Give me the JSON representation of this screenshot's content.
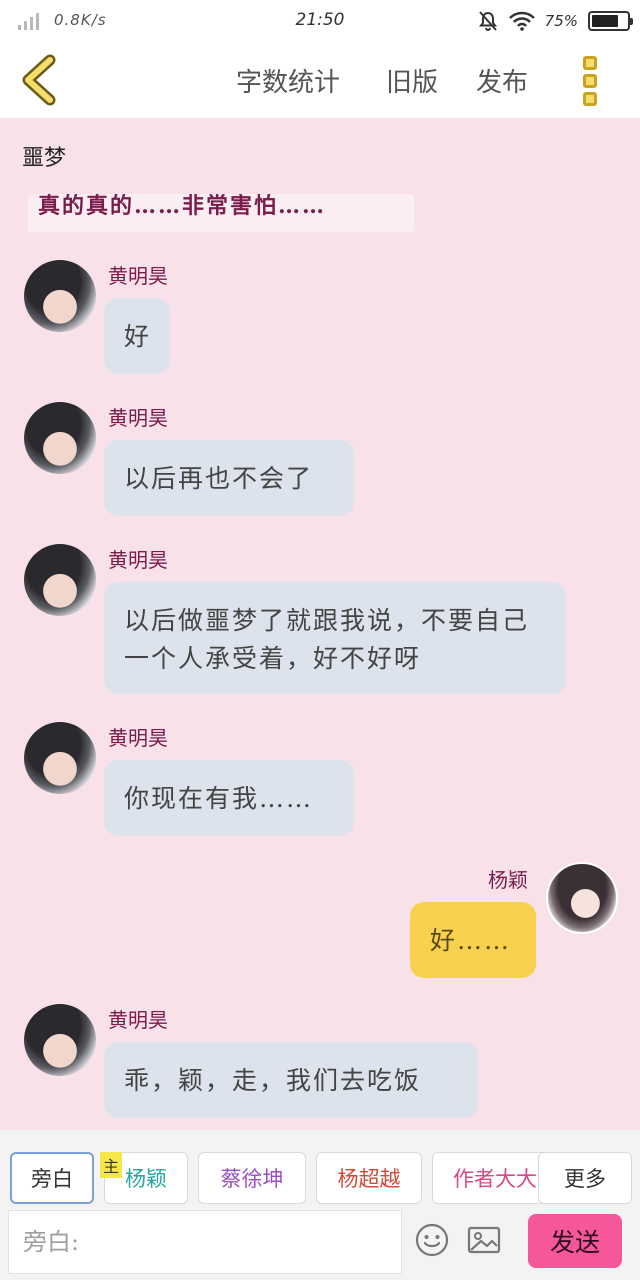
{
  "status_bar": {
    "speed": "0.8K/s",
    "time": "21:50",
    "battery_text": "75%",
    "battery_level": 0.75
  },
  "nav": {
    "word_count": "字数统计",
    "old_version": "旧版",
    "publish": "发布"
  },
  "chat": {
    "title": "噩梦",
    "cut_message": "真的真的……非常害怕……",
    "messages": [
      {
        "sender": "黄明昊",
        "text": "好",
        "side": "left"
      },
      {
        "sender": "黄明昊",
        "text": "以后再也不会了",
        "side": "left"
      },
      {
        "sender": "黄明昊",
        "text": "以后做噩梦了就跟我说，不要自己一个人承受着，好不好呀",
        "side": "left"
      },
      {
        "sender": "黄明昊",
        "text": "你现在有我……",
        "side": "left"
      },
      {
        "sender": "杨颖",
        "text": "好……",
        "side": "right"
      },
      {
        "sender": "黄明昊",
        "text": "乖，颖，走，我们去吃饭",
        "side": "left"
      }
    ]
  },
  "bottom": {
    "roles": [
      {
        "label": "旁白",
        "color": "#444444"
      },
      {
        "label": "杨颖",
        "color": "#27a6a0"
      },
      {
        "label": "蔡徐坤",
        "color": "#9b4fc4"
      },
      {
        "label": "杨超越",
        "color": "#d44a3a"
      },
      {
        "label": "作者大大",
        "color": "#d64a8a"
      }
    ],
    "main_tag": "主",
    "more": "更多",
    "input_placeholder": "旁白:",
    "send": "发送"
  },
  "colors": {
    "background": "#f9e1ea",
    "bubble_other": "#dde3ec",
    "bubble_own": "#f8d24f",
    "sender_name": "#7a1c4c",
    "send_button": "#f6569a",
    "accent_yellow": "#f4dd6a"
  },
  "icons": [
    "signal-icon",
    "mute-icon",
    "wifi-icon",
    "battery-icon",
    "back-icon",
    "more-icon",
    "emoji-icon",
    "image-icon"
  ]
}
